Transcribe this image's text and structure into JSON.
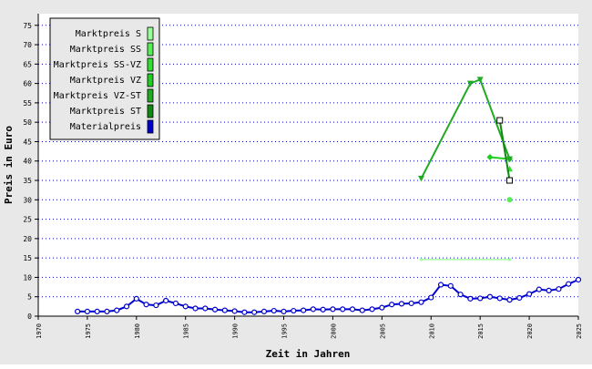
{
  "chart_data": {
    "type": "line",
    "title": "",
    "xlabel": "Zeit in Jahren",
    "ylabel": "Preis in Euro",
    "xlim": [
      1970,
      2025
    ],
    "ylim": [
      0,
      78
    ],
    "x_ticks": [
      1970,
      1975,
      1980,
      1985,
      1990,
      1995,
      2000,
      2005,
      2010,
      2015,
      2020,
      2025
    ],
    "y_ticks": [
      0,
      5,
      10,
      15,
      20,
      25,
      30,
      35,
      40,
      45,
      50,
      55,
      60,
      65,
      70,
      75
    ],
    "grid": {
      "horizontal": true,
      "style": "dotted",
      "color": "#0000cc"
    },
    "legend_position": "top-left",
    "series": [
      {
        "name": "Marktpreis S",
        "color": "#99ff99",
        "marker": "dot",
        "points": [
          [
            2009,
            14.6
          ],
          [
            2018,
            14.6
          ]
        ]
      },
      {
        "name": "Marktpreis SS",
        "color": "#55ee55",
        "marker": "circle-filled",
        "points": [
          [
            2018,
            30
          ]
        ]
      },
      {
        "name": "Marktpreis SS-VZ",
        "color": "#33dd33",
        "marker": "triangle-up",
        "points": [
          [
            2018,
            38
          ]
        ]
      },
      {
        "name": "Marktpreis VZ",
        "color": "#22cc22",
        "marker": "diamond",
        "points": [
          [
            2016,
            41
          ],
          [
            2018,
            40.5
          ]
        ]
      },
      {
        "name": "Marktpreis VZ-ST",
        "color": "#22aa22",
        "marker": "triangle-down",
        "points": [
          [
            2009,
            35.5
          ],
          [
            2014,
            60
          ],
          [
            2015,
            61
          ],
          [
            2018,
            40.5
          ]
        ]
      },
      {
        "name": "Marktpreis ST",
        "color": "#118811",
        "marker": "square-open",
        "points": [
          [
            2017,
            50.5
          ],
          [
            2018,
            35
          ]
        ]
      },
      {
        "name": "Materialpreis",
        "color": "#0000cc",
        "marker": "circle-open",
        "points": [
          [
            1974,
            1.2
          ],
          [
            1975,
            1.2
          ],
          [
            1976,
            1.2
          ],
          [
            1977,
            1.2
          ],
          [
            1978,
            1.5
          ],
          [
            1979,
            2.5
          ],
          [
            1980,
            4.5
          ],
          [
            1981,
            3.0
          ],
          [
            1982,
            2.8
          ],
          [
            1983,
            4.0
          ],
          [
            1984,
            3.3
          ],
          [
            1985,
            2.5
          ],
          [
            1986,
            2.0
          ],
          [
            1987,
            2.0
          ],
          [
            1988,
            1.7
          ],
          [
            1989,
            1.5
          ],
          [
            1990,
            1.3
          ],
          [
            1991,
            1.0
          ],
          [
            1992,
            1.0
          ],
          [
            1993,
            1.2
          ],
          [
            1994,
            1.4
          ],
          [
            1995,
            1.2
          ],
          [
            1996,
            1.4
          ],
          [
            1997,
            1.5
          ],
          [
            1998,
            1.8
          ],
          [
            1999,
            1.7
          ],
          [
            2000,
            1.8
          ],
          [
            2001,
            1.8
          ],
          [
            2002,
            1.8
          ],
          [
            2003,
            1.5
          ],
          [
            2004,
            1.8
          ],
          [
            2005,
            2.2
          ],
          [
            2006,
            3.0
          ],
          [
            2007,
            3.2
          ],
          [
            2008,
            3.3
          ],
          [
            2009,
            3.6
          ],
          [
            2010,
            4.8
          ],
          [
            2011,
            8.1
          ],
          [
            2012,
            7.8
          ],
          [
            2013,
            5.6
          ],
          [
            2014,
            4.5
          ],
          [
            2015,
            4.6
          ],
          [
            2016,
            5.0
          ],
          [
            2017,
            4.6
          ],
          [
            2018,
            4.2
          ],
          [
            2019,
            4.7
          ],
          [
            2020,
            5.7
          ],
          [
            2021,
            6.9
          ],
          [
            2022,
            6.6
          ],
          [
            2023,
            7.0
          ],
          [
            2024,
            8.3
          ],
          [
            2025,
            9.4
          ]
        ]
      }
    ]
  }
}
